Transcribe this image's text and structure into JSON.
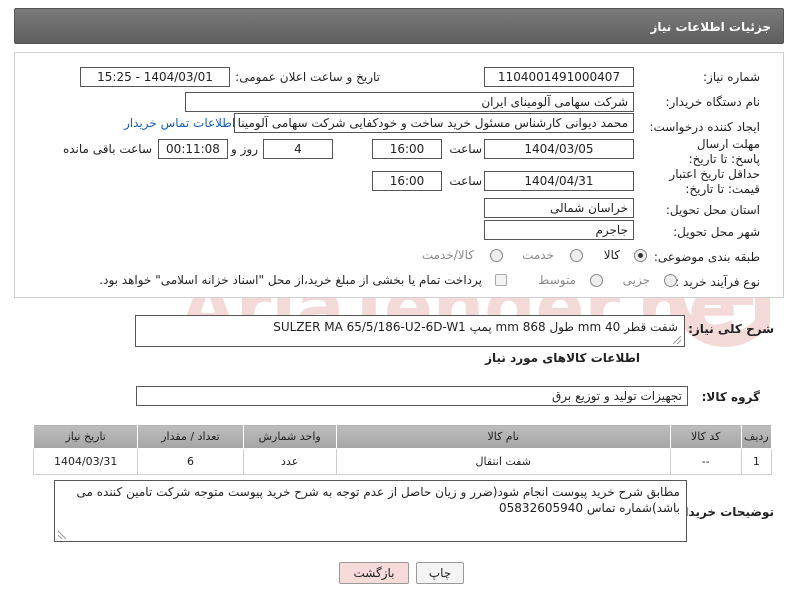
{
  "header": {
    "title": "جزئیات اطلاعات نیاز"
  },
  "form": {
    "need_number_label": "شماره نیاز:",
    "need_number": "1104001491000407",
    "announce_label": "تاریخ و ساعت اعلان عمومی:",
    "announce_value": "1404/03/01 - 15:25",
    "buyer_org_label": "نام دستگاه خریدار:",
    "buyer_org": "شرکت سهامی آلومینای ایران",
    "creator_label": "ایجاد کننده درخواست:",
    "creator": "محمد دیوانی کارشناس مسئول خرید ساخت و خودکفایی شرکت سهامی آلومینا",
    "buyer_contact_link": "اطلاعات تماس خریدار",
    "deadline_label": "مهلت ارسال پاسخ: تا تاریخ:",
    "deadline_date": "1404/03/05",
    "time_label": "ساعت",
    "deadline_time": "16:00",
    "days_value": "4",
    "days_label": "روز و",
    "remaining_time": "00:11:08",
    "remaining_label": "ساعت باقی مانده",
    "price_validity_label": "حداقل تاریخ اعتبار قیمت: تا تاریخ:",
    "price_validity_date": "1404/04/31",
    "price_validity_time": "16:00",
    "province_label": "استان محل تحویل:",
    "province": "خراسان شمالی",
    "city_label": "شهر محل تحویل:",
    "city": "جاجرم",
    "category_label": "طبقه بندی موضوعی:",
    "category_options": [
      "کالا",
      "خدمت",
      "کالا/خدمت"
    ],
    "category_selected": "کالا",
    "process_label": "نوع فرآیند خرید :",
    "process_options": [
      "جزیی",
      "متوسط"
    ],
    "payment_note": "پرداخت تمام یا بخشی از مبلغ خرید،از محل \"اسناد خزانه اسلامی\" خواهد بود."
  },
  "summary": {
    "label": "شرح کلی نیاز:",
    "value": "شفت قطر 40 mm طول 868 mm پمپ SULZER  MA 65/5/186-U2-6D-W1"
  },
  "goods": {
    "section_title": "اطلاعات کالاهای مورد نیاز",
    "group_label": "گروه کالا:",
    "group_value": "تجهیزات تولید و توزیع برق",
    "columns": [
      "ردیف",
      "کد کالا",
      "نام کالا",
      "واحد شمارش",
      "تعداد / مقدار",
      "تاریخ نیاز"
    ],
    "rows": [
      {
        "row": "1",
        "code": "--",
        "name": "شفت انتقال",
        "unit": "عدد",
        "qty": "6",
        "date": "1404/03/31"
      }
    ]
  },
  "buyer_notes": {
    "label": "توضیحات خریدار:",
    "value": "مطابق شرح خرید پیوست انجام شود(ضرر و زیان حاصل از عدم توجه به شرح خرید پیوست متوجه شرکت تامین کننده می باشد)شماره تماس 05832605940"
  },
  "buttons": {
    "print": "چاپ",
    "back": "بازگشت"
  },
  "watermark_text": "AriaTender.neT",
  "colors": {
    "header_bg": "#6b6b6b",
    "link": "#1a5fb4",
    "back_button_bg": "#f7dada",
    "watermark": "#c0392b"
  }
}
